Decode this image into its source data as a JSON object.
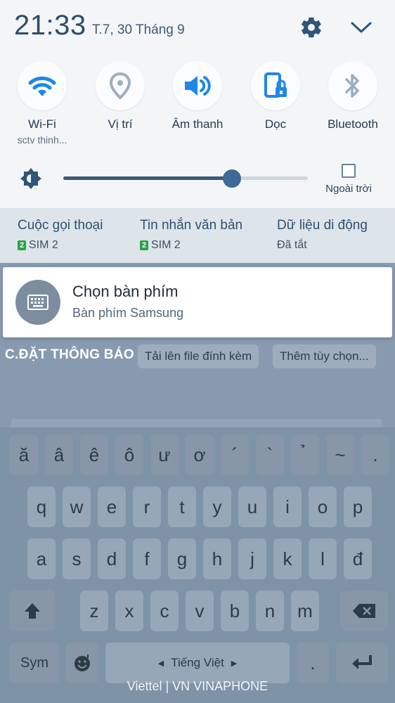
{
  "status": {
    "time": "21:33",
    "date": "T.7, 30 Tháng 9"
  },
  "quick_settings": [
    {
      "label": "Wi-Fi",
      "sub": "sctv thinh...",
      "icon": "wifi-icon"
    },
    {
      "label": "Vị trí",
      "sub": "",
      "icon": "location-icon"
    },
    {
      "label": "Âm thanh",
      "sub": "",
      "icon": "sound-icon"
    },
    {
      "label": "Dọc",
      "sub": "",
      "icon": "portrait-lock-icon"
    },
    {
      "label": "Bluetooth",
      "sub": "",
      "icon": "bluetooth-icon"
    }
  ],
  "brightness": {
    "level": 0.69,
    "outdoor_label": "Ngoài trời",
    "outdoor_checked": false
  },
  "usage": [
    {
      "title": "Cuộc gọi thoại",
      "badge": "2",
      "value": "SIM 2"
    },
    {
      "title": "Tin nhắn văn bản",
      "badge": "2",
      "value": "SIM 2"
    },
    {
      "title": "Dữ liệu di động",
      "badge": "",
      "value": "Đã tắt"
    }
  ],
  "notification": {
    "title": "Chọn bàn phím",
    "subtitle": "Bàn phím Samsung",
    "icon": "keyboard-icon"
  },
  "background": {
    "chips": [
      "Tải lên file đính kèm",
      "Thêm tùy chọn..."
    ],
    "settings_label": "C.ĐẶT THÔNG BÁO"
  },
  "keyboard": {
    "row1": [
      "ă",
      "â",
      "ê",
      "ô",
      "ư",
      "ơ",
      "´",
      "`",
      "̉",
      "~",
      "."
    ],
    "row2": [
      "q",
      "w",
      "e",
      "r",
      "t",
      "y",
      "u",
      "i",
      "o",
      "p"
    ],
    "row3": [
      "a",
      "s",
      "d",
      "f",
      "g",
      "h",
      "j",
      "k",
      "l",
      "đ"
    ],
    "row4": [
      "z",
      "x",
      "c",
      "v",
      "b",
      "n",
      "m"
    ],
    "sym_label": "Sym",
    "space_label": "Tiếng Việt",
    "period": "."
  },
  "carrier": "Viettel | VN VINAPHONE",
  "colors": {
    "accent": "#3d6a96",
    "panel": "#f3f5f7",
    "scrim": "#879ab0"
  }
}
